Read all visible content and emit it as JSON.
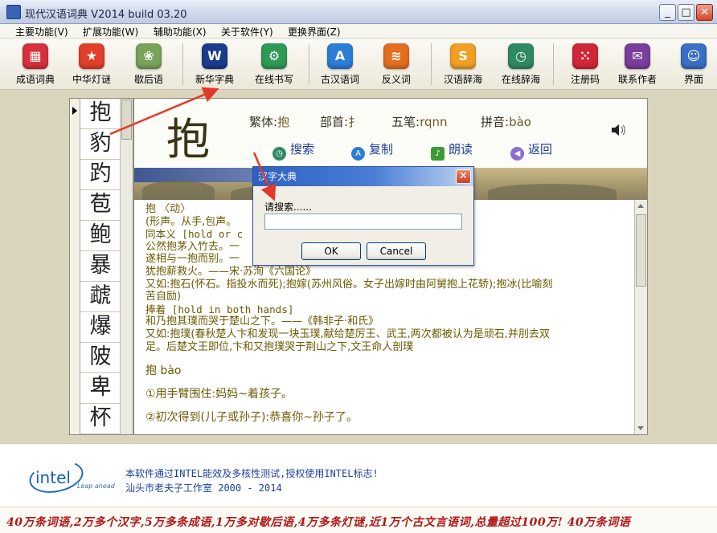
{
  "window": {
    "title": "现代汉语词典 V2014 build 03.20",
    "min": "_",
    "max": "□",
    "close": "✕"
  },
  "menu": [
    "主要功能(V)",
    "扩展功能(W)",
    "辅助功能(X)",
    "关于软件(Y)",
    "更换界面(Z)"
  ],
  "toolbar": [
    {
      "label": "成语词典",
      "icon": "grid-icon",
      "color": "#d6303d"
    },
    {
      "label": "中华灯谜",
      "icon": "star-icon",
      "color": "#e0402a"
    },
    {
      "label": "歇后语",
      "icon": "flower-icon",
      "color": "#7aa35a"
    },
    {
      "label": "新华字典",
      "icon": "w-logo-icon",
      "color": "#1a3c8f"
    },
    {
      "label": "在线书写",
      "icon": "gear-icon",
      "color": "#2e9a56"
    },
    {
      "label": "古汉语词",
      "icon": "app-store-icon",
      "color": "#2a7ed6"
    },
    {
      "label": "反义词",
      "icon": "rss-icon",
      "color": "#e46e1f"
    },
    {
      "label": "汉语辞海",
      "icon": "s-logo-icon",
      "color": "#f1a024"
    },
    {
      "label": "在线辞海",
      "icon": "clock-icon",
      "color": "#2f8a64"
    },
    {
      "label": "注册码",
      "icon": "dice-icon",
      "color": "#d1263a"
    },
    {
      "label": "联系作者",
      "icon": "mail-icon",
      "color": "#7a3e9c"
    },
    {
      "label": "界面",
      "icon": "finder-icon",
      "color": "#3b6ec4"
    }
  ],
  "char_list": [
    "抱",
    "豹",
    "趵",
    "苞",
    "鲍",
    "暴",
    "虣",
    "爆",
    "陂",
    "卑",
    "杯"
  ],
  "entry": {
    "char": "抱",
    "traditional_label": "繁体:",
    "traditional": "抱",
    "radical_label": "部首:",
    "radical": "扌",
    "wubi_label": "五笔:",
    "wubi": "rqnn",
    "pinyin_label": "拼音:",
    "pinyin": "bào"
  },
  "actions": [
    {
      "label": "搜索",
      "icon": "clock-icon",
      "color": "#2f8a64"
    },
    {
      "label": "复制",
      "icon": "app-store-icon",
      "color": "#2a7ed6"
    },
    {
      "label": "朗读",
      "icon": "microphone-icon",
      "color": "#3b9a36"
    },
    {
      "label": "返回",
      "icon": "back-icon",
      "color": "#8a6fd0"
    }
  ],
  "definition": [
    "抱 〈动〉",
    "(形声。从手,包声。",
    "同本义 [hold or c",
    "公然抱茅入竹去。一",
    "遂相与一抱而别。一",
    "犹抱薪救火。——宋·苏洵《六国论》",
    "又如:抱石(怀石。指投水而死);抱嫁(苏州风俗。女子出嫁时由阿舅抱上花轿);抱冰(比喻刻",
    "苦自励)",
    "捧着 [hold in both hands]",
    "和乃抱其璞而哭于楚山之下。——《韩非子·和氏》",
    "又如:抱璞(春秋楚人卞和发现一块玉璞,献给楚厉王、武王,两次都被认为是顽石,并刖去双",
    "足。后楚文王即位,卞和又抱璞哭于荆山之下,文王命人剖璞"
  ],
  "definition2": [
    "抱 bào",
    "①用手臂围住:妈妈~着孩子。",
    "②初次得到(儿子或孙子):恭喜你~孙子了。"
  ],
  "dialog": {
    "title": "汉字大典",
    "prompt": "请搜索......",
    "value": "",
    "ok": "OK",
    "cancel": "Cancel",
    "close": "✕"
  },
  "footer": {
    "logo": "intel",
    "tagline": "Leap ahead",
    "line1": "本软件通过INTEL能效及多核性测试,授权使用INTEL标志!",
    "line2": "汕头市老夫子工作室 2000 - 2014",
    "marquee": "40万条词语,2万多个汉字,5万多条成语,1万多对歇后语,4万多条灯谜,近1万个古文言语词,总量超过100万! 40万条词语"
  }
}
